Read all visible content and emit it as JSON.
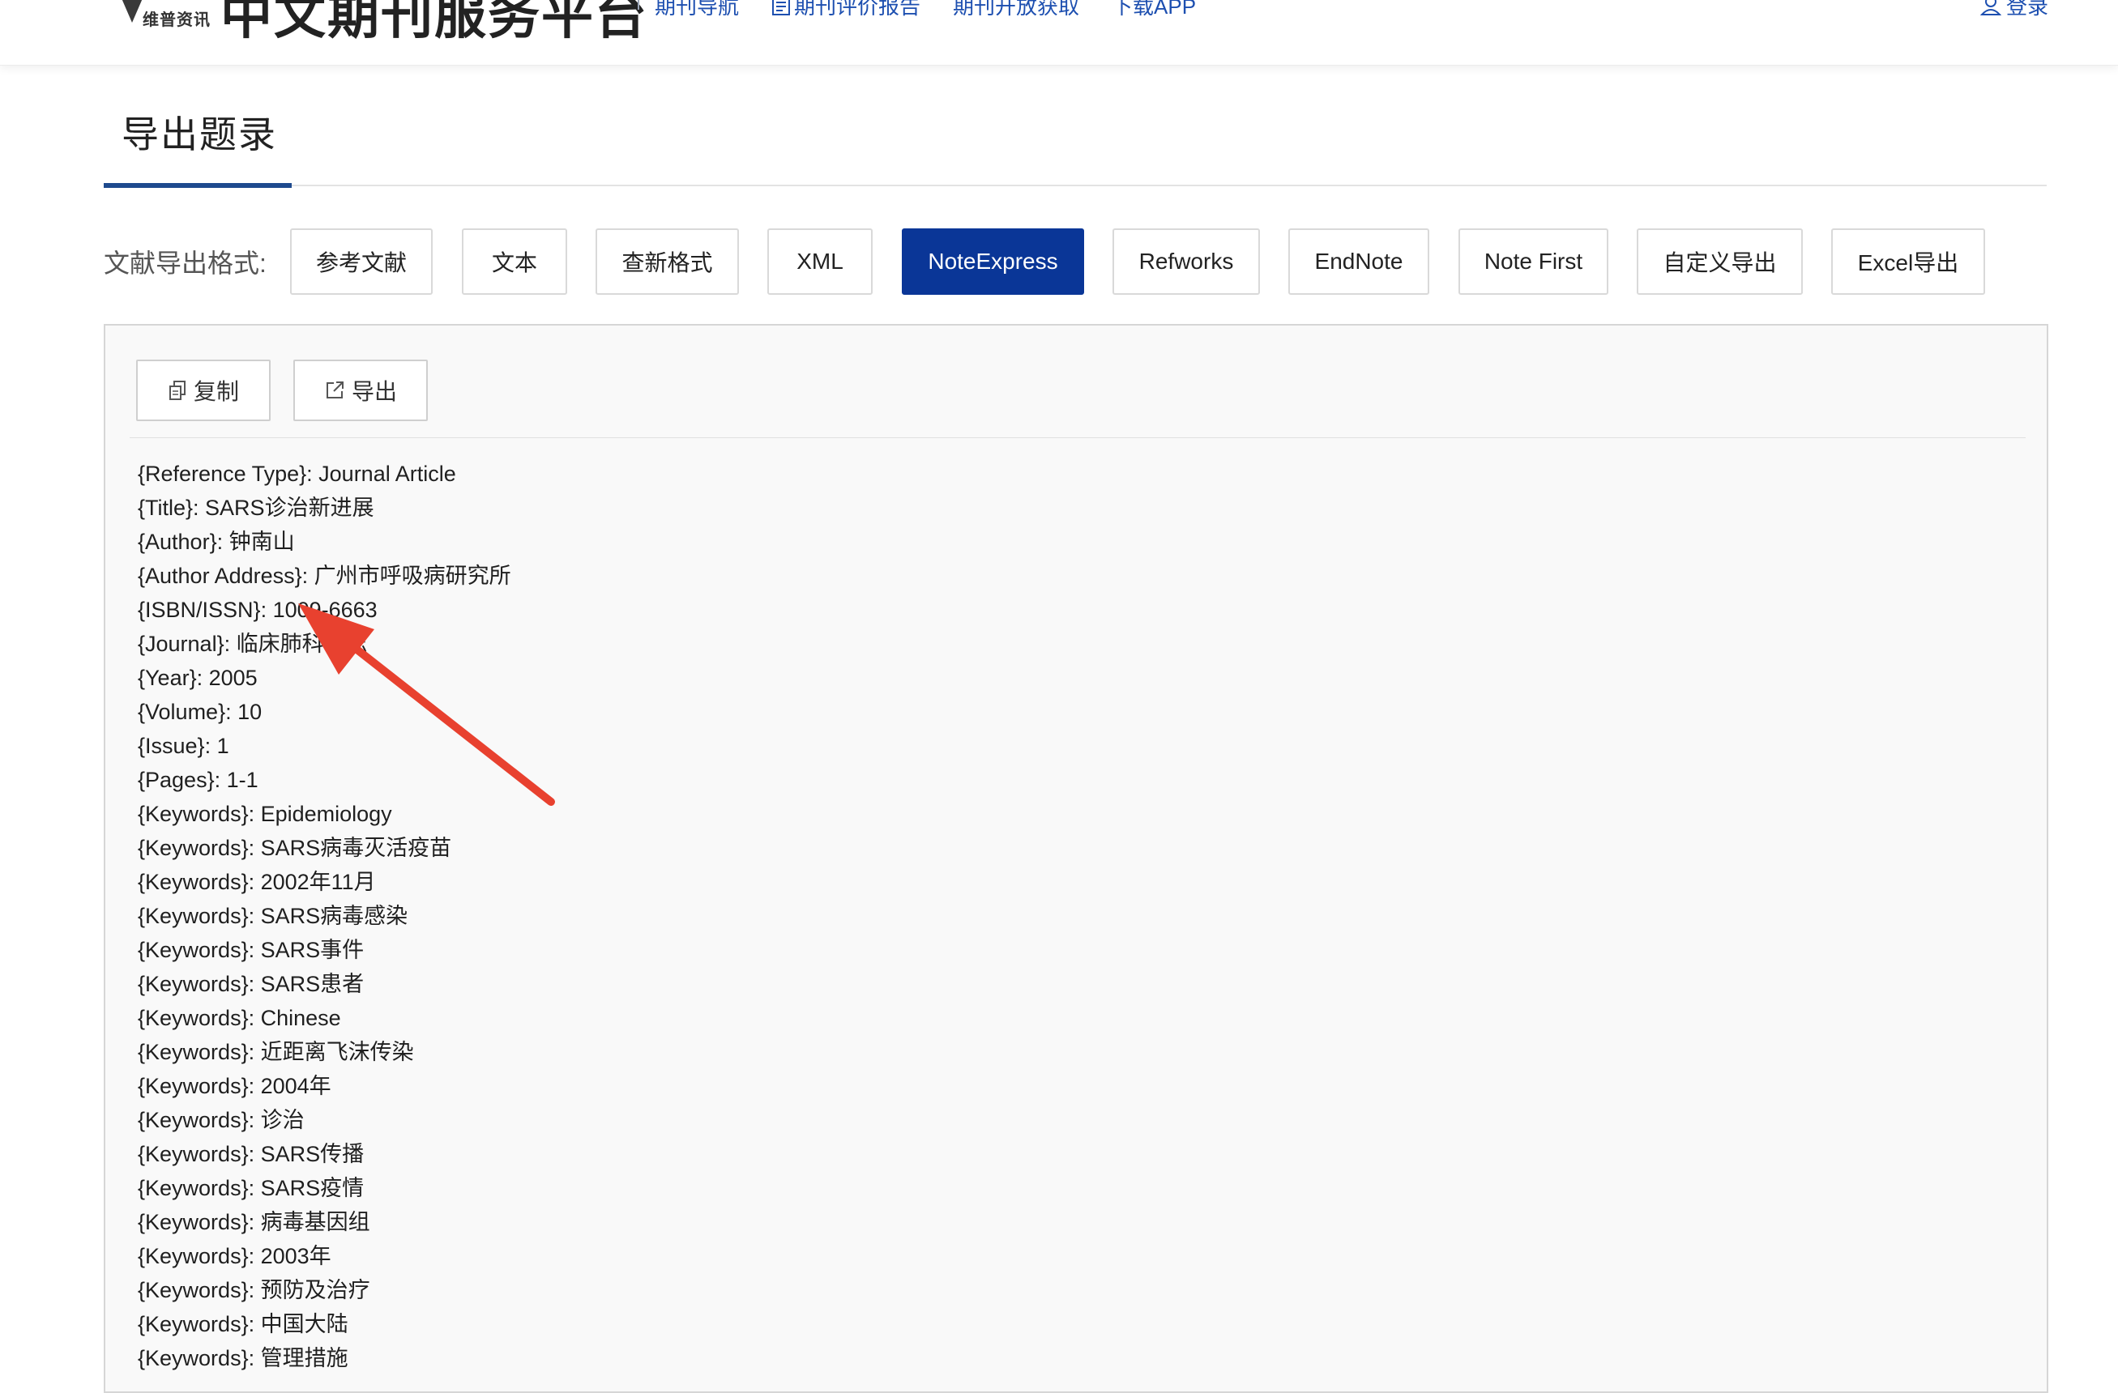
{
  "header": {
    "logo_caption": "维普资讯",
    "site_title": "中文期刊服务平台",
    "nav": [
      {
        "label": "期刊导航",
        "icon": ""
      },
      {
        "label": "期刊评价报告",
        "icon": "document-icon"
      },
      {
        "label": "期刊开放获取",
        "icon": ""
      },
      {
        "label": "下载APP",
        "icon": ""
      }
    ],
    "login_label": "登录",
    "colors": {
      "nav_link": "#1d4fb0"
    }
  },
  "section": {
    "title": "导出题录",
    "accent_color": "#1e4a8e"
  },
  "format": {
    "label": "文献导出格式:",
    "options": [
      "参考文献",
      "文本",
      "查新格式",
      "XML",
      "NoteExpress",
      "Refworks",
      "EndNote",
      "Note First",
      "自定义导出",
      "Excel导出"
    ],
    "selected": "NoteExpress",
    "active_color": "#0a3697"
  },
  "toolbar": {
    "copy_label": "复制",
    "export_label": "导出"
  },
  "content": {
    "lines": [
      "{Reference Type}: Journal Article",
      "{Title}: SARS诊治新进展",
      "{Author}: 钟南山",
      "{Author Address}: 广州市呼吸病研究所",
      "{ISBN/ISSN}: 1009-6663",
      "{Journal}: 临床肺科杂志",
      "{Year}: 2005",
      "{Volume}: 10",
      "{Issue}: 1",
      "{Pages}: 1-1",
      "{Keywords}: Epidemiology",
      "{Keywords}: SARS病毒灭活疫苗",
      "{Keywords}: 2002年11月",
      "{Keywords}: SARS病毒感染",
      "{Keywords}: SARS事件",
      "{Keywords}: SARS患者",
      "{Keywords}: Chinese",
      "{Keywords}: 近距离飞沫传染",
      "{Keywords}: 2004年",
      "{Keywords}: 诊治",
      "{Keywords}: SARS传播",
      "{Keywords}: SARS疫情",
      "{Keywords}: 病毒基因组",
      "{Keywords}: 2003年",
      "{Keywords}: 预防及治疗",
      "{Keywords}: 中国大陆",
      "{Keywords}: 管理措施"
    ]
  },
  "annotation": {
    "arrow_color": "#e8412f"
  }
}
